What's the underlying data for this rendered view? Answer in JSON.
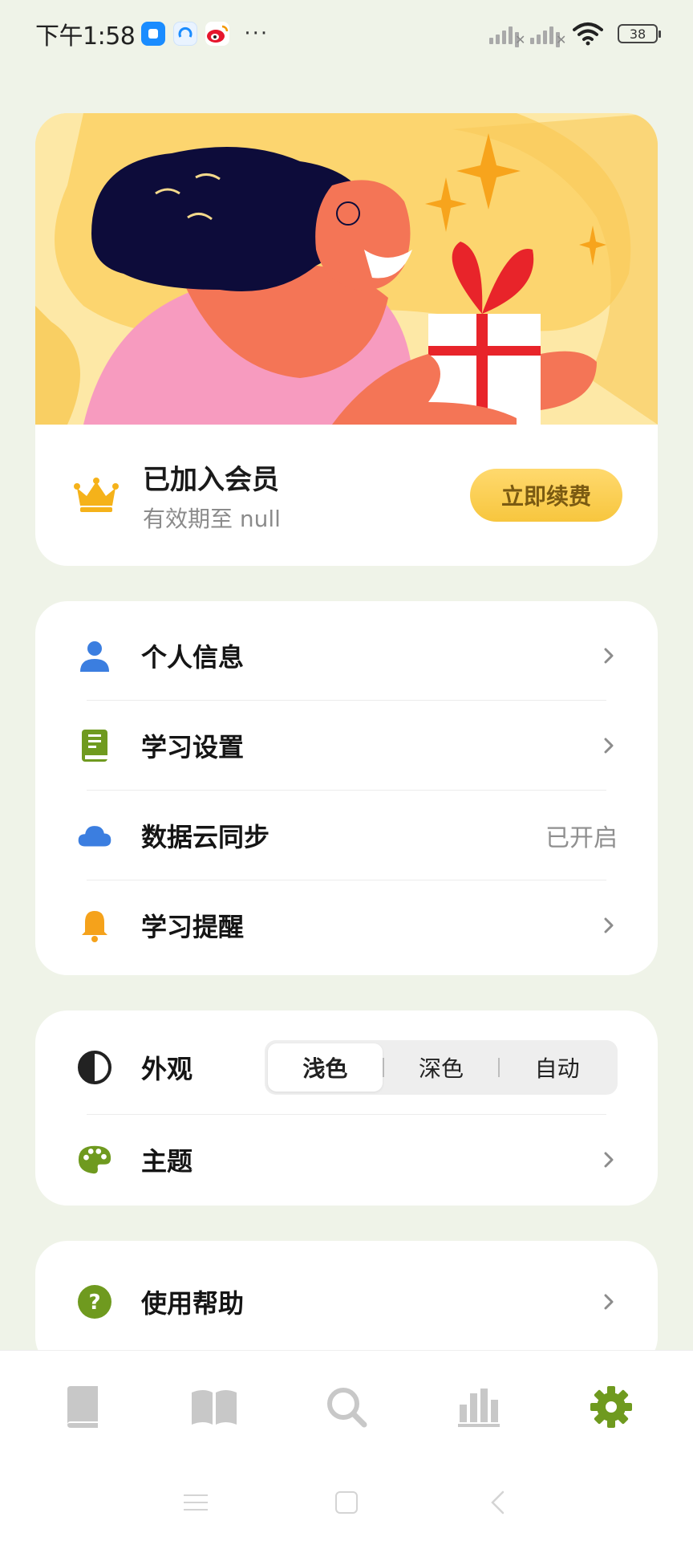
{
  "status_bar": {
    "time": "下午1:58",
    "more": "···",
    "battery": "38"
  },
  "membership": {
    "title": "已加入会员",
    "subtitle": "有效期至 null",
    "renew_label": "立即续费"
  },
  "settings": {
    "items": [
      {
        "label": "个人信息"
      },
      {
        "label": "学习设置"
      },
      {
        "label": "数据云同步",
        "value": "已开启"
      },
      {
        "label": "学习提醒"
      }
    ]
  },
  "appearance": {
    "label": "外观",
    "options": [
      "浅色",
      "深色",
      "自动"
    ],
    "selected": "浅色",
    "theme_label": "主题"
  },
  "help": {
    "label": "使用帮助"
  },
  "colors": {
    "background": "#eff3e8",
    "accent_green": "#6f9a1f",
    "accent_blue": "#3b7ee0",
    "accent_orange": "#f5a21b",
    "renew_button": "#f7c63e",
    "nav_inactive": "#c8c8c8"
  },
  "bottom_nav": {
    "items": [
      {
        "icon": "book-icon",
        "active": false
      },
      {
        "icon": "open-book-icon",
        "active": false
      },
      {
        "icon": "search-icon",
        "active": false
      },
      {
        "icon": "bar-chart-icon",
        "active": false
      },
      {
        "icon": "gear-icon",
        "active": true
      }
    ]
  }
}
